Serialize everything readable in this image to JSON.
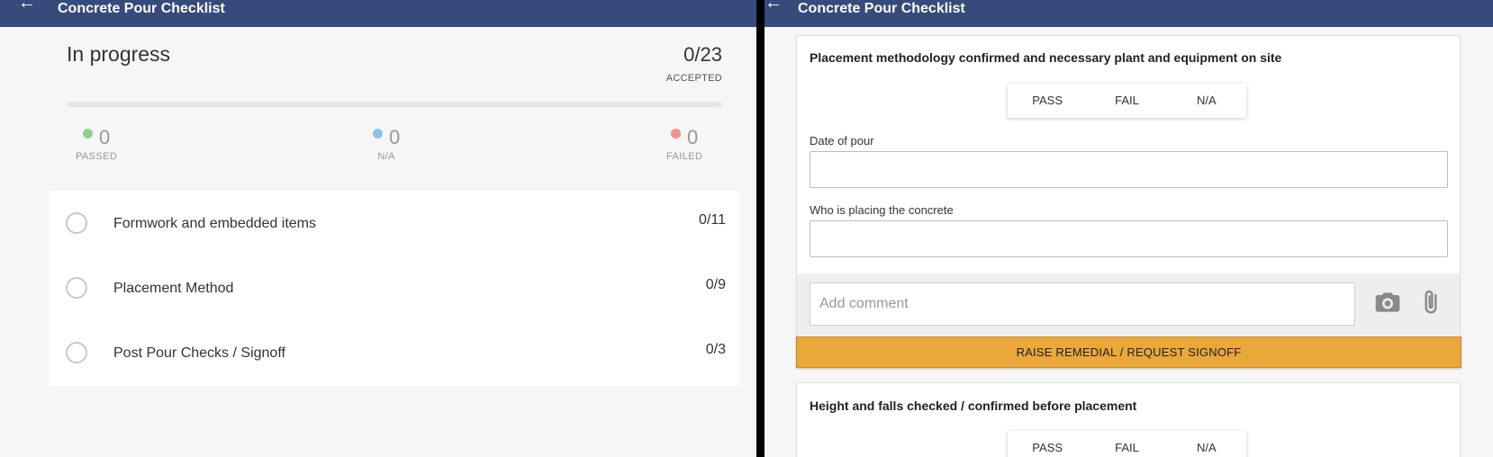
{
  "left": {
    "header": {
      "back_icon": "arrow-left-icon",
      "title": "Concrete Pour Checklist"
    },
    "status": {
      "label": "In progress",
      "count": "0/23",
      "count_label": "ACCEPTED",
      "progress": 0
    },
    "stats": [
      {
        "value": "0",
        "label": "PASSED",
        "color": "#8fd18c"
      },
      {
        "value": "0",
        "label": "N/A",
        "color": "#8cc4ef"
      },
      {
        "value": "0",
        "label": "FAILED",
        "color": "#ef8f8f"
      }
    ],
    "sections": [
      {
        "name": "Formwork and embedded items",
        "count": "0/11"
      },
      {
        "name": "Placement Method",
        "count": "0/9"
      },
      {
        "name": "Post Pour Checks / Signoff",
        "count": "0/3"
      }
    ]
  },
  "right": {
    "header": {
      "back_icon": "arrow-left-icon",
      "title": "Concrete Pour Checklist"
    },
    "items": [
      {
        "question": "Placement methodology confirmed and necessary plant and equipment on site",
        "options": [
          "PASS",
          "FAIL",
          "N/A"
        ],
        "fields": [
          {
            "label": "Date of pour",
            "value": ""
          },
          {
            "label": "Who is placing the concrete",
            "value": ""
          }
        ],
        "comment_placeholder": "Add comment",
        "camera_icon": "camera-icon",
        "attach_icon": "paperclip-icon",
        "action_label": "RAISE REMEDIAL / REQUEST SIGNOFF"
      },
      {
        "question": "Height and falls checked / confirmed before placement",
        "options": [
          "PASS",
          "FAIL",
          "N/A"
        ]
      }
    ]
  },
  "colors": {
    "header": "#374a7c",
    "action": "#eaa73a"
  }
}
